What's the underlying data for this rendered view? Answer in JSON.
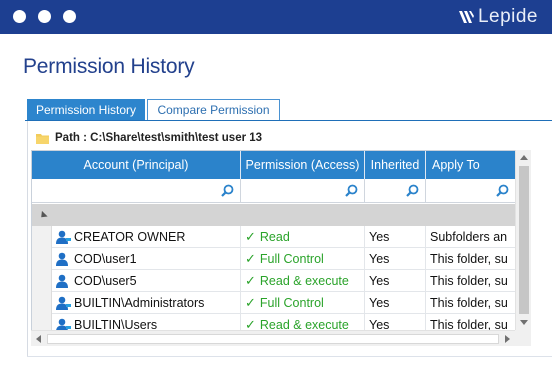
{
  "brand": {
    "name": "Lepide"
  },
  "page": {
    "title": "Permission History"
  },
  "tabs": [
    {
      "label": "Permission History",
      "active": true
    },
    {
      "label": "Compare Permission",
      "active": false
    }
  ],
  "path": {
    "text": "Path : C:\\Share\\test\\smith\\test user 13"
  },
  "grid": {
    "columns": [
      "Account (Principal)",
      "Permission (Access)",
      "Inherited",
      "Apply To"
    ],
    "rows": [
      {
        "account": "CREATOR OWNER",
        "permission": "Read",
        "inherited": "Yes",
        "apply_to": "Subfolders an"
      },
      {
        "account": "COD\\user1",
        "permission": "Full Control",
        "inherited": "Yes",
        "apply_to": "This folder, su"
      },
      {
        "account": "COD\\user5",
        "permission": "Read & execute",
        "inherited": "Yes",
        "apply_to": "This folder, su"
      },
      {
        "account": "BUILTIN\\Administrators",
        "permission": "Full Control",
        "inherited": "Yes",
        "apply_to": "This folder, su"
      },
      {
        "account": "BUILTIN\\Users",
        "permission": "Read & execute",
        "inherited": "Yes",
        "apply_to": "This folder, su"
      }
    ]
  },
  "colors": {
    "header_bar": "#1d3f91",
    "accent": "#2b83cb",
    "permission_green": "#2aa32a",
    "title": "#23418d"
  },
  "icons": [
    "window-dot-icon",
    "lepide-logo-icon",
    "folder-icon",
    "search-icon",
    "user-icon",
    "checkmark-icon",
    "expand-triangle-icon"
  ]
}
